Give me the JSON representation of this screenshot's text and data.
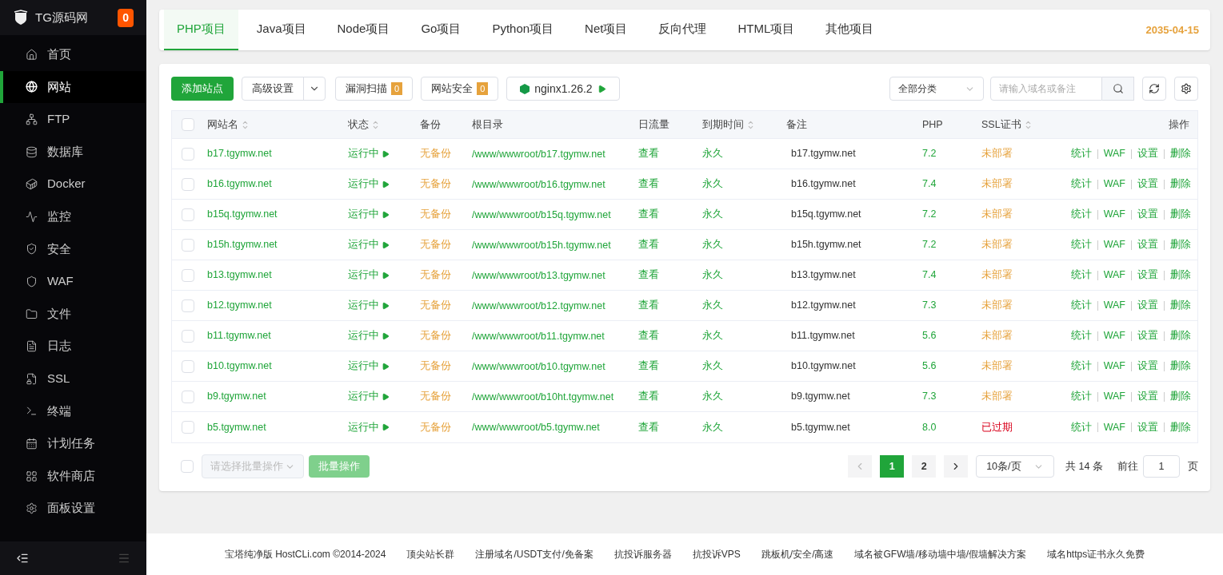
{
  "brand": {
    "name": "TG源码网",
    "badge": "0"
  },
  "sidebar": {
    "items": [
      {
        "label": "首页",
        "selected": false
      },
      {
        "label": "网站",
        "selected": true
      },
      {
        "label": "FTP",
        "selected": false
      },
      {
        "label": "数据库",
        "selected": false
      },
      {
        "label": "Docker",
        "selected": false
      },
      {
        "label": "监控",
        "selected": false
      },
      {
        "label": "安全",
        "selected": false
      },
      {
        "label": "WAF",
        "selected": false
      },
      {
        "label": "文件",
        "selected": false
      },
      {
        "label": "日志",
        "selected": false
      },
      {
        "label": "SSL",
        "selected": false
      },
      {
        "label": "终端",
        "selected": false
      },
      {
        "label": "计划任务",
        "selected": false
      },
      {
        "label": "软件商店",
        "selected": false
      },
      {
        "label": "面板设置",
        "selected": false
      }
    ]
  },
  "tabs": [
    {
      "label": "PHP项目",
      "selected": true
    },
    {
      "label": "Java项目",
      "selected": false
    },
    {
      "label": "Node项目",
      "selected": false
    },
    {
      "label": "Go项目",
      "selected": false
    },
    {
      "label": "Python项目",
      "selected": false
    },
    {
      "label": "Net项目",
      "selected": false
    },
    {
      "label": "反向代理",
      "selected": false
    },
    {
      "label": "HTML项目",
      "selected": false
    },
    {
      "label": "其他项目",
      "selected": false
    }
  ],
  "date": "2035-04-15",
  "toolbar": {
    "add": "添加站点",
    "advanced": "高级设置",
    "scan": {
      "label": "漏洞扫描",
      "count": "0"
    },
    "security": {
      "label": "网站安全",
      "count": "0"
    },
    "nginx": "nginx1.26.2",
    "category": "全部分类",
    "search_placeholder": "请输入域名或备注"
  },
  "table": {
    "select_all": {
      "checked": false
    },
    "columns": [
      {
        "label": "网站名",
        "sortable": true
      },
      {
        "label": "状态",
        "sortable": true
      },
      {
        "label": "备份",
        "sortable": false
      },
      {
        "label": "根目录",
        "sortable": false
      },
      {
        "label": "日流量",
        "sortable": false
      },
      {
        "label": "到期时间",
        "sortable": true
      },
      {
        "label": "备注",
        "sortable": false
      },
      {
        "label": "PHP",
        "sortable": false
      },
      {
        "label": "SSL证书",
        "sortable": true
      },
      {
        "label": "操作",
        "sortable": false
      }
    ],
    "rows": [
      {
        "checked": false,
        "name": "b17.tgymw.net",
        "status": "运行中",
        "backup": "无备份",
        "root": "/www/wwwroot/b17.tgymw.net",
        "traffic": "查看",
        "expiry": "永久",
        "remark": "b17.tgymw.net",
        "php": "7.2",
        "ssl": {
          "text": "未部署",
          "kind": "none"
        },
        "actions": [
          "统计",
          "WAF",
          "设置",
          "删除"
        ]
      },
      {
        "checked": false,
        "name": "b16.tgymw.net",
        "status": "运行中",
        "backup": "无备份",
        "root": "/www/wwwroot/b16.tgymw.net",
        "traffic": "查看",
        "expiry": "永久",
        "remark": "b16.tgymw.net",
        "php": "7.4",
        "ssl": {
          "text": "未部署",
          "kind": "none"
        },
        "actions": [
          "统计",
          "WAF",
          "设置",
          "删除"
        ]
      },
      {
        "checked": false,
        "name": "b15q.tgymw.net",
        "status": "运行中",
        "backup": "无备份",
        "root": "/www/wwwroot/b15q.tgymw.net",
        "traffic": "查看",
        "expiry": "永久",
        "remark": "b15q.tgymw.net",
        "php": "7.2",
        "ssl": {
          "text": "未部署",
          "kind": "none"
        },
        "actions": [
          "统计",
          "WAF",
          "设置",
          "删除"
        ]
      },
      {
        "checked": false,
        "name": "b15h.tgymw.net",
        "status": "运行中",
        "backup": "无备份",
        "root": "/www/wwwroot/b15h.tgymw.net",
        "traffic": "查看",
        "expiry": "永久",
        "remark": "b15h.tgymw.net",
        "php": "7.2",
        "ssl": {
          "text": "未部署",
          "kind": "none"
        },
        "actions": [
          "统计",
          "WAF",
          "设置",
          "删除"
        ]
      },
      {
        "checked": false,
        "name": "b13.tgymw.net",
        "status": "运行中",
        "backup": "无备份",
        "root": "/www/wwwroot/b13.tgymw.net",
        "traffic": "查看",
        "expiry": "永久",
        "remark": "b13.tgymw.net",
        "php": "7.4",
        "ssl": {
          "text": "未部署",
          "kind": "none"
        },
        "actions": [
          "统计",
          "WAF",
          "设置",
          "删除"
        ]
      },
      {
        "checked": false,
        "name": "b12.tgymw.net",
        "status": "运行中",
        "backup": "无备份",
        "root": "/www/wwwroot/b12.tgymw.net",
        "traffic": "查看",
        "expiry": "永久",
        "remark": "b12.tgymw.net",
        "php": "7.3",
        "ssl": {
          "text": "未部署",
          "kind": "none"
        },
        "actions": [
          "统计",
          "WAF",
          "设置",
          "删除"
        ]
      },
      {
        "checked": false,
        "name": "b11.tgymw.net",
        "status": "运行中",
        "backup": "无备份",
        "root": "/www/wwwroot/b11.tgymw.net",
        "traffic": "查看",
        "expiry": "永久",
        "remark": "b11.tgymw.net",
        "php": "5.6",
        "ssl": {
          "text": "未部署",
          "kind": "none"
        },
        "actions": [
          "统计",
          "WAF",
          "设置",
          "删除"
        ]
      },
      {
        "checked": false,
        "name": "b10.tgymw.net",
        "status": "运行中",
        "backup": "无备份",
        "root": "/www/wwwroot/b10.tgymw.net",
        "traffic": "查看",
        "expiry": "永久",
        "remark": "b10.tgymw.net",
        "php": "5.6",
        "ssl": {
          "text": "未部署",
          "kind": "none"
        },
        "actions": [
          "统计",
          "WAF",
          "设置",
          "删除"
        ]
      },
      {
        "checked": false,
        "name": "b9.tgymw.net",
        "status": "运行中",
        "backup": "无备份",
        "root": "/www/wwwroot/b10ht.tgymw.net",
        "traffic": "查看",
        "expiry": "永久",
        "remark": "b9.tgymw.net",
        "php": "7.3",
        "ssl": {
          "text": "未部署",
          "kind": "none"
        },
        "actions": [
          "统计",
          "WAF",
          "设置",
          "删除"
        ]
      },
      {
        "checked": false,
        "name": "b5.tgymw.net",
        "status": "运行中",
        "backup": "无备份",
        "root": "/www/wwwroot/b5.tgymw.net",
        "traffic": "查看",
        "expiry": "永久",
        "remark": "b5.tgymw.net",
        "php": "8.0",
        "ssl": {
          "text": "已过期",
          "kind": "expired"
        },
        "actions": [
          "统计",
          "WAF",
          "设置",
          "删除"
        ]
      }
    ]
  },
  "footer_bar": {
    "checked": false,
    "batch_placeholder": "请选择批量操作",
    "batch_button": "批量操作",
    "pages": [
      {
        "label": "1",
        "selected": true
      },
      {
        "label": "2",
        "selected": false
      }
    ],
    "page_size": "10条/页",
    "total": "共 14 条",
    "goto_label": "前往",
    "goto_value": "1",
    "page_unit": "页"
  },
  "footer_links": [
    "宝塔纯净版 HostCLi.com ©2014-2024",
    "顶尖站长群",
    "注册域名/USDT支付/免备案",
    "抗投诉服务器",
    "抗投诉VPS",
    "跳板机/安全/高速",
    "域名被GFW墙/移动墙中墙/假墙解决方案",
    "域名https证书永久免费"
  ]
}
